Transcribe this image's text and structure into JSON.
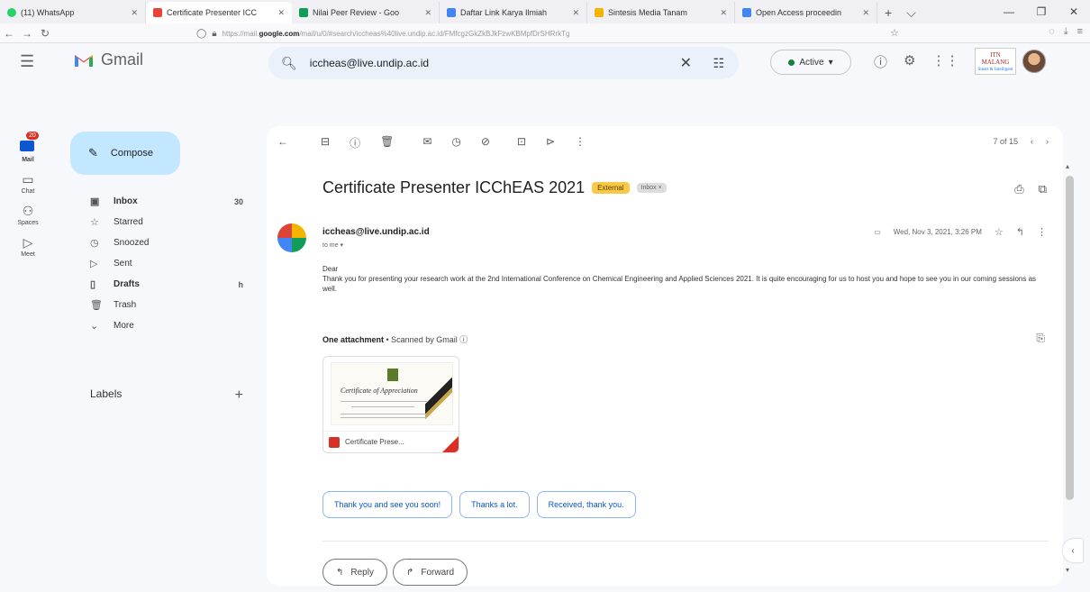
{
  "browser": {
    "tabs": [
      {
        "label": "(11) WhatsApp",
        "color": "#25d366"
      },
      {
        "label": "Certificate Presenter ICC",
        "color": "#ea4335",
        "active": true
      },
      {
        "label": "Nilai Peer Review - Goo",
        "color": "#0f9d58"
      },
      {
        "label": "Daftar Link Karya Ilmiah",
        "color": "#4285f4"
      },
      {
        "label": "Sintesis Media Tanam",
        "color": "#f4b400"
      },
      {
        "label": "Open Access proceedin",
        "color": "#4285f4"
      }
    ],
    "new_tab": "+",
    "url_prefix": "https://mail.",
    "url_domain": "google.com",
    "url_rest": "/mail/u/0/#search/iccheas%40live.undip.ac.id/FMfcgzGkZkBJkFzwKBMpfDrSHRrkTg"
  },
  "gmail": {
    "product": "Gmail",
    "search_value": "iccheas@live.undip.ac.id",
    "status": "Active",
    "org_logo_title": "ITN MALANG",
    "org_logo_sub": "Smart & Intelligent"
  },
  "rail": {
    "mail_badge": "20",
    "items": [
      "Mail",
      "Chat",
      "Spaces",
      "Meet"
    ]
  },
  "sidebar": {
    "compose": "Compose",
    "items": [
      {
        "label": "Inbox",
        "icon": "inbox-icon",
        "count": "30",
        "bold": true
      },
      {
        "label": "Starred",
        "icon": "star-icon",
        "count": ""
      },
      {
        "label": "Snoozed",
        "icon": "clock-icon",
        "count": ""
      },
      {
        "label": "Sent",
        "icon": "send-icon",
        "count": ""
      },
      {
        "label": "Drafts",
        "icon": "draft-icon",
        "count": "h",
        "bold": true
      },
      {
        "label": "Trash",
        "icon": "trash-icon",
        "count": ""
      },
      {
        "label": "More",
        "icon": "chevron-down-icon",
        "count": ""
      }
    ],
    "labels": "Labels"
  },
  "email": {
    "pager": "7 of 15",
    "subject": "Certificate Presenter ICChEAS 2021",
    "chip_external": "External",
    "chip_inbox": "Inbox ×",
    "sender": "iccheas@live.undip.ac.id",
    "to": "to me ▾",
    "date": "Wed, Nov 3, 2021, 3:26 PM",
    "greeting": "Dear",
    "body": "Thank you for presenting your research work at the 2nd International Conference on Chemical Engineering and Applied Sciences 2021. It is quite encouraging for us to host you and hope to see you in our coming sessions as well.",
    "attachment_title": "One attachment",
    "attachment_note": " • Scanned by Gmail ⓘ",
    "attachment_name": "Certificate Prese...",
    "cert_heading": "Certificate of Appreciation",
    "smart_replies": [
      "Thank you and see you soon!",
      "Thanks a lot.",
      "Received, thank you."
    ],
    "reply": "Reply",
    "forward": "Forward"
  }
}
